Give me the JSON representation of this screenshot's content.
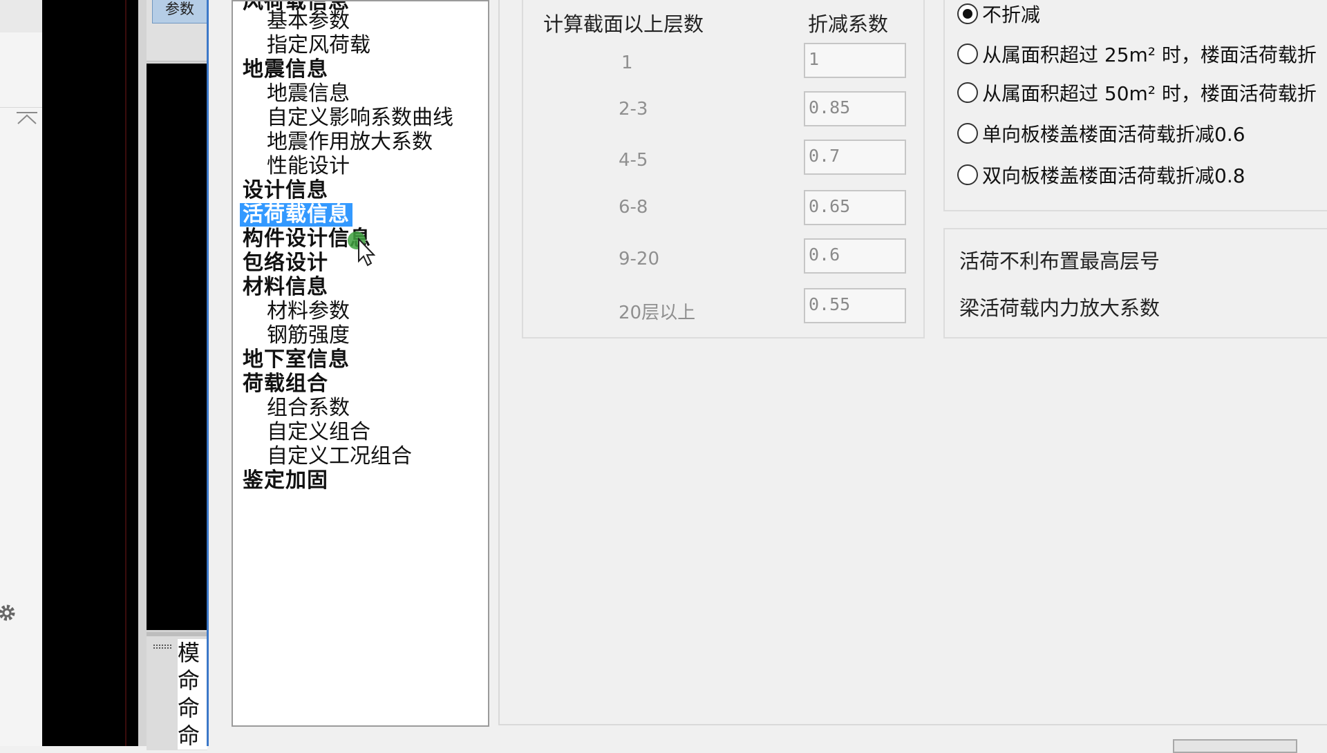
{
  "left_panel": {
    "params_tab": "参数",
    "command_lines": [
      "模",
      "命",
      "命",
      "命"
    ]
  },
  "tree": {
    "items": [
      {
        "label": "风荷载信息",
        "level": "category"
      },
      {
        "label": "基本参数",
        "level": "sub"
      },
      {
        "label": "指定风荷载",
        "level": "sub"
      },
      {
        "label": "地震信息",
        "level": "category"
      },
      {
        "label": "地震信息",
        "level": "sub"
      },
      {
        "label": "自定义影响系数曲线",
        "level": "sub"
      },
      {
        "label": "地震作用放大系数",
        "level": "sub"
      },
      {
        "label": "性能设计",
        "level": "sub"
      },
      {
        "label": "设计信息",
        "level": "category"
      },
      {
        "label": "活荷载信息",
        "level": "category",
        "selected": true
      },
      {
        "label": "构件设计信息",
        "level": "category"
      },
      {
        "label": "包络设计",
        "level": "category"
      },
      {
        "label": "材料信息",
        "level": "category"
      },
      {
        "label": "材料参数",
        "level": "sub"
      },
      {
        "label": "钢筋强度",
        "level": "sub"
      },
      {
        "label": "地下室信息",
        "level": "category"
      },
      {
        "label": "荷载组合",
        "level": "category"
      },
      {
        "label": "组合系数",
        "level": "sub"
      },
      {
        "label": "自定义组合",
        "level": "sub"
      },
      {
        "label": "自定义工况组合",
        "level": "sub"
      },
      {
        "label": "鉴定加固",
        "level": "category"
      }
    ]
  },
  "reduction_table": {
    "header_floors": "计算截面以上层数",
    "header_factor": "折减系数",
    "rows": [
      {
        "floors": "1",
        "factor": "1"
      },
      {
        "floors": "2-3",
        "factor": "0.85"
      },
      {
        "floors": "4-5",
        "factor": "0.7"
      },
      {
        "floors": "6-8",
        "factor": "0.65"
      },
      {
        "floors": "9-20",
        "factor": "0.6"
      },
      {
        "floors": "20层以上",
        "factor": "0.55"
      }
    ]
  },
  "radio_options": [
    {
      "label": "不折减",
      "checked": true
    },
    {
      "label": "从属面积超过 25m² 时，楼面活荷载折",
      "checked": false
    },
    {
      "label": "从属面积超过 50m² 时，楼面活荷载折",
      "checked": false
    },
    {
      "label": "单向板楼盖楼面活荷载折减0.6",
      "checked": false
    },
    {
      "label": "双向板楼盖楼面活荷载折减0.8",
      "checked": false
    }
  ],
  "other_settings": {
    "live_load_top_floor": "活荷不利布置最高层号",
    "beam_amplification": "梁活荷载内力放大系数"
  }
}
